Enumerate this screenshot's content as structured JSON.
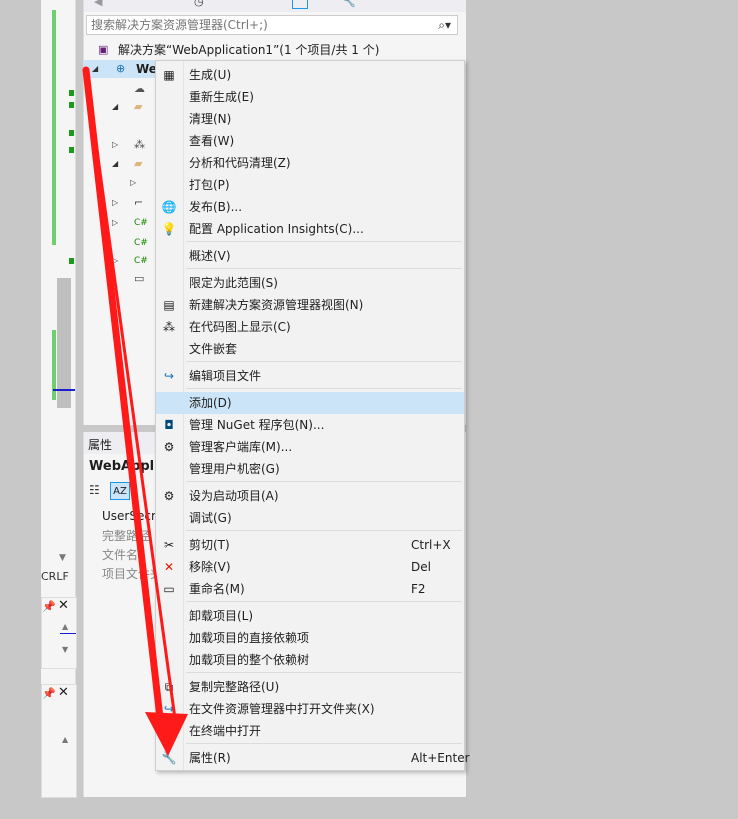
{
  "colors": {
    "accent_blue": "#1c97ea",
    "highlight": "#cce4f7",
    "annotation_red": "#ff1a1a",
    "menu_bg": "#f2f2f2"
  },
  "editor_status": {
    "line_ending": "CRLF"
  },
  "solution_explorer": {
    "search_placeholder": "搜索解决方案资源管理器(Ctrl+;)",
    "solution_label": "解决方案“WebApplication1”(1 个项目/共 1 个)",
    "project_label": "We"
  },
  "properties_panel": {
    "title": "属性",
    "object": "WebApplic",
    "rows": [
      "UserSecr",
      "完整路径",
      "文件名",
      "项目文件夹"
    ]
  },
  "context_menu": {
    "items": [
      {
        "label": "生成(U)",
        "icon": "build-icon"
      },
      {
        "label": "重新生成(E)",
        "icon": ""
      },
      {
        "label": "清理(N)",
        "icon": ""
      },
      {
        "label": "查看(W)",
        "icon": ""
      },
      {
        "label": "分析和代码清理(Z)",
        "icon": ""
      },
      {
        "label": "打包(P)",
        "icon": ""
      },
      {
        "label": "发布(B)...",
        "icon": "globe-icon"
      },
      {
        "label": "配置 Application Insights(C)...",
        "icon": "insights-icon"
      },
      {
        "label": "概述(V)",
        "icon": ""
      },
      {
        "label": "限定为此范围(S)",
        "icon": ""
      },
      {
        "label": "新建解决方案资源管理器视图(N)",
        "icon": "new-view-icon"
      },
      {
        "label": "在代码图上显示(C)",
        "icon": "code-map-icon"
      },
      {
        "label": "文件嵌套",
        "icon": ""
      },
      {
        "label": "编辑项目文件",
        "icon": "edit-arrow-icon"
      },
      {
        "label": "添加(D)",
        "icon": ""
      },
      {
        "label": "管理 NuGet 程序包(N)...",
        "icon": "nuget-icon"
      },
      {
        "label": "管理客户端库(M)...",
        "icon": "library-icon"
      },
      {
        "label": "管理用户机密(G)",
        "icon": ""
      },
      {
        "label": "设为启动项目(A)",
        "icon": "gear-icon"
      },
      {
        "label": "调试(G)",
        "icon": ""
      },
      {
        "label": "剪切(T)",
        "icon": "scissors-icon",
        "shortcut": "Ctrl+X"
      },
      {
        "label": "移除(V)",
        "icon": "remove-x-icon",
        "shortcut": "Del"
      },
      {
        "label": "重命名(M)",
        "icon": "rename-icon",
        "shortcut": "F2"
      },
      {
        "label": "卸载项目(L)",
        "icon": ""
      },
      {
        "label": "加载项目的直接依赖项",
        "icon": ""
      },
      {
        "label": "加载项目的整个依赖树",
        "icon": ""
      },
      {
        "label": "复制完整路径(U)",
        "icon": "copy-icon"
      },
      {
        "label": "在文件资源管理器中打开文件夹(X)",
        "icon": "open-folder-arrow-icon"
      },
      {
        "label": "在终端中打开",
        "icon": "terminal-icon"
      },
      {
        "label": "属性(R)",
        "icon": "wrench-icon",
        "shortcut": "Alt+Enter"
      }
    ]
  }
}
